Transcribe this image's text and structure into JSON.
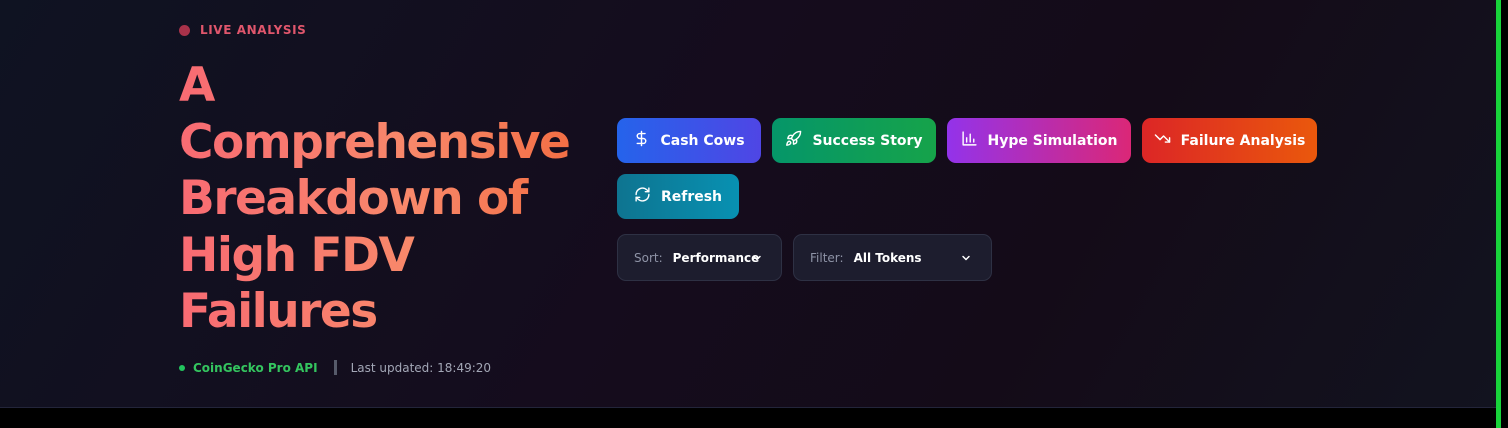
{
  "badge": {
    "label": "LIVE ANALYSIS",
    "color": "#e0566c"
  },
  "hero": {
    "title_lines": [
      "A",
      "Comprehensive",
      "Breakdown of",
      "High FDV",
      "Failures"
    ]
  },
  "status": {
    "source": "CoinGecko Pro API",
    "last_updated": "Last updated: 18:49:20"
  },
  "actions": {
    "cash_cows": {
      "label": "Cash Cows",
      "icon": "dollar-icon"
    },
    "success_story": {
      "label": "Success Story",
      "icon": "rocket-icon"
    },
    "hype_simulation": {
      "label": "Hype Simulation",
      "icon": "bar-chart-icon"
    },
    "failure_analysis": {
      "label": "Failure Analysis",
      "icon": "trending-down-icon"
    },
    "refresh": {
      "label": "Refresh",
      "icon": "refresh-icon"
    }
  },
  "controls": {
    "sort": {
      "label": "Sort:",
      "value": "Performance"
    },
    "filter": {
      "label": "Filter:",
      "value": "All Tokens"
    }
  },
  "colors": {
    "accent_green": "#18d43a",
    "title_gradient": [
      "#f86b73",
      "#f26a3e"
    ]
  }
}
